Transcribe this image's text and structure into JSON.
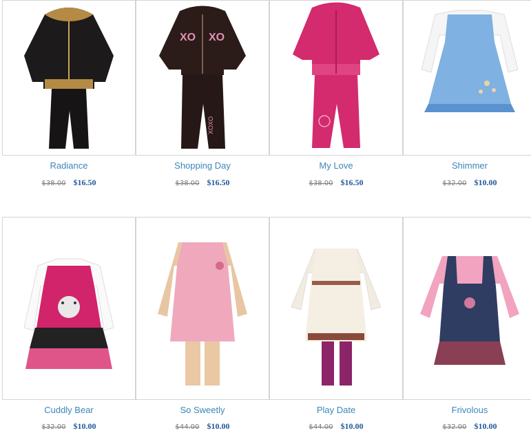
{
  "products": [
    {
      "name": "Radiance",
      "old_price": "$38.00",
      "price": "$16.50",
      "icon": "black-velour-tracksuit-image"
    },
    {
      "name": "Shopping Day",
      "old_price": "$38.00",
      "price": "$16.50",
      "icon": "brown-xo-tracksuit-image"
    },
    {
      "name": "My Love",
      "old_price": "$38.00",
      "price": "$16.50",
      "icon": "pink-velour-tracksuit-image"
    },
    {
      "name": "Shimmer",
      "old_price": "$32.00",
      "price": "$10.00",
      "icon": "blue-jumper-dress-image"
    },
    {
      "name": "Cuddly Bear",
      "old_price": "$32.00",
      "price": "$10.00",
      "icon": "bear-jumper-dress-image"
    },
    {
      "name": "So Sweetly",
      "old_price": "$44.00",
      "price": "$10.00",
      "icon": "pink-sweater-dress-image"
    },
    {
      "name": "Play Date",
      "old_price": "$44.00",
      "price": "$10.00",
      "icon": "cream-sweater-set-image"
    },
    {
      "name": "Frivolous",
      "old_price": "$32.00",
      "price": "$10.00",
      "icon": "denim-jumper-dress-image"
    }
  ],
  "colors": {
    "link": "#3a86b8",
    "price": "#1e5799",
    "old_price": "#7a7a7a",
    "border": "#d4d4d4"
  }
}
